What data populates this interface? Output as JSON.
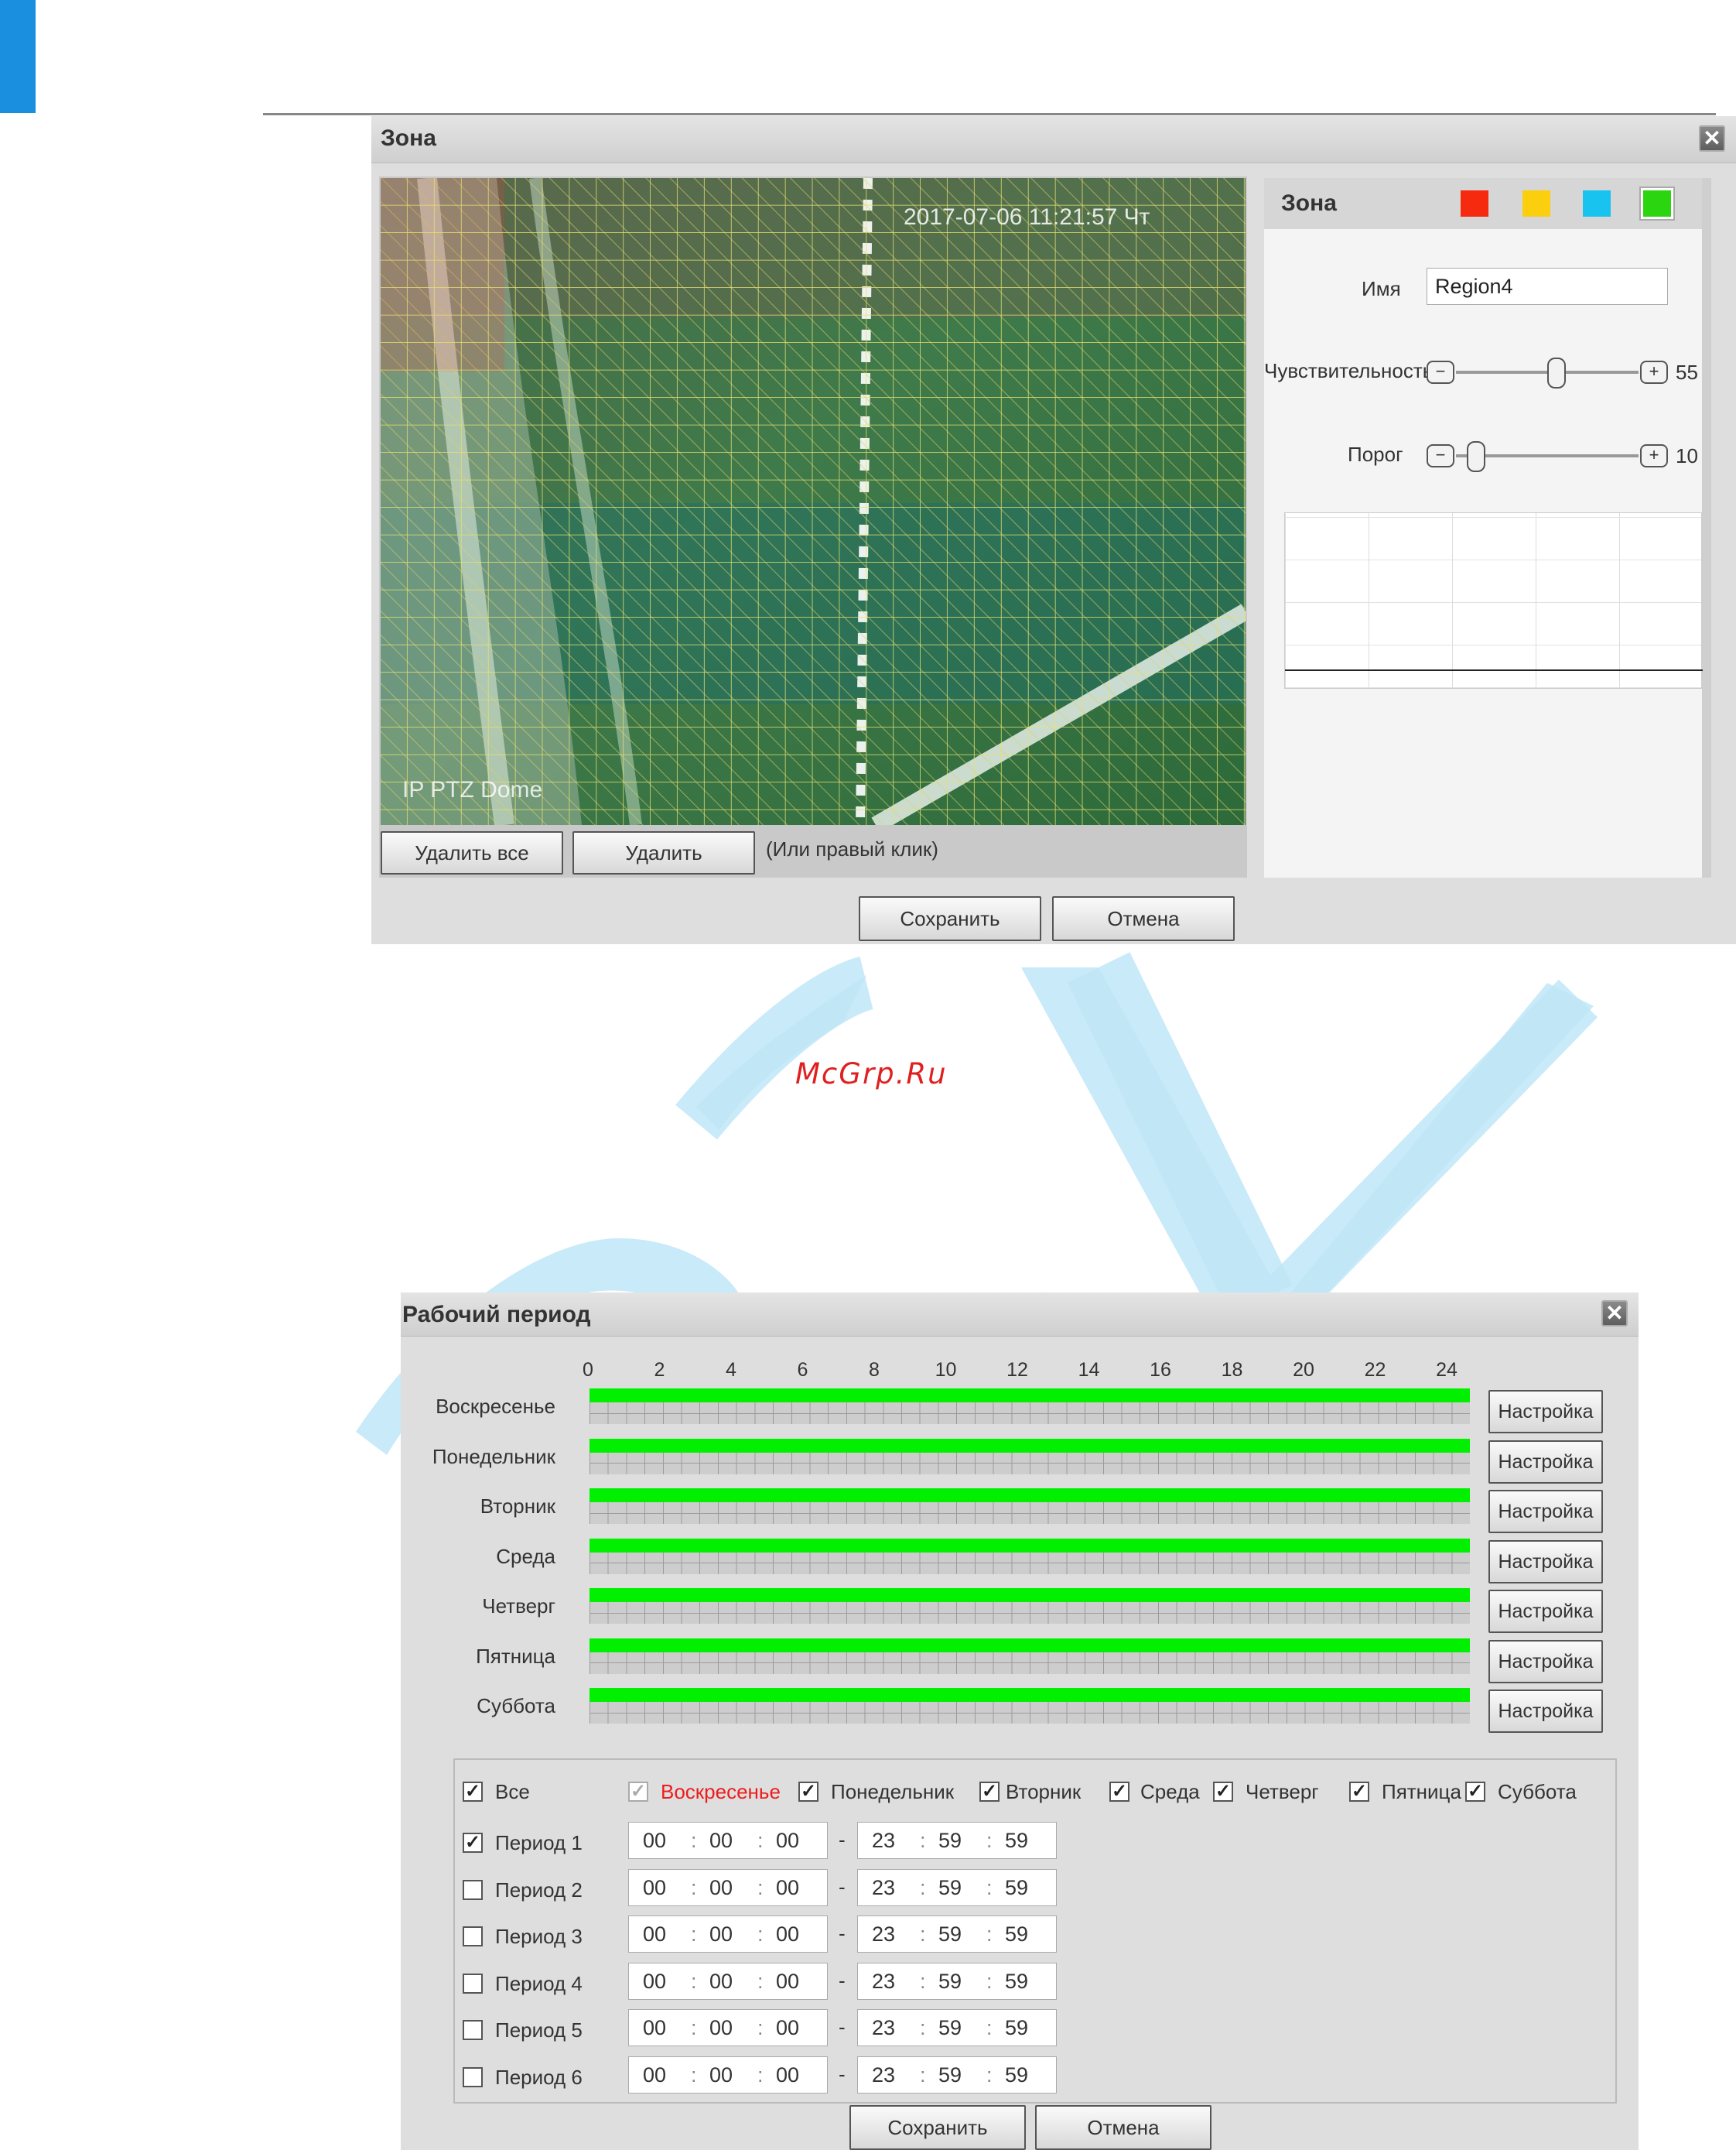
{
  "zone_dialog": {
    "title": "Зона",
    "close_glyph": "✕",
    "video": {
      "timestamp": "2017-07-06 11:21:57 Чт",
      "camera_label": "IP PTZ Dome"
    },
    "delete_all_label": "Удалить все",
    "delete_label": "Удалить",
    "hint": "(Или правый клик)",
    "save_label": "Сохранить",
    "cancel_label": "Отмена",
    "panel": {
      "title": "Зона",
      "colors": [
        "#f52a0f",
        "#fccf0e",
        "#19c3ef",
        "#2bd50f"
      ],
      "selected_color_index": 3,
      "name_label": "Имя",
      "name_value": "Region4",
      "sensitivity_label": "Чувствительность",
      "sensitivity_value": "55",
      "threshold_label": "Порог",
      "threshold_value": "10",
      "minus_glyph": "−",
      "plus_glyph": "+"
    }
  },
  "watermark": "McGrp.Ru",
  "work_period_dialog": {
    "title": "Рабочий период",
    "close_glyph": "✕",
    "hours": [
      "0",
      "2",
      "4",
      "6",
      "8",
      "10",
      "12",
      "14",
      "16",
      "18",
      "20",
      "22",
      "24"
    ],
    "days": [
      {
        "label": "Воскресенье",
        "button": "Настройка"
      },
      {
        "label": "Понедельник",
        "button": "Настройка"
      },
      {
        "label": "Вторник",
        "button": "Настройка"
      },
      {
        "label": "Среда",
        "button": "Настройка"
      },
      {
        "label": "Четверг",
        "button": "Настройка"
      },
      {
        "label": "Пятница",
        "button": "Настройка"
      },
      {
        "label": "Суббота",
        "button": "Настройка"
      }
    ],
    "all_label": "Все",
    "day_checkboxes": [
      {
        "label": "Воскресенье",
        "checked": true,
        "highlight": "#ee1c1c"
      },
      {
        "label": "Понедельник",
        "checked": true
      },
      {
        "label": "Вторник",
        "checked": true
      },
      {
        "label": "Среда",
        "checked": true
      },
      {
        "label": "Четверг",
        "checked": true
      },
      {
        "label": "Пятница",
        "checked": true
      },
      {
        "label": "Суббота",
        "checked": true
      }
    ],
    "periods": [
      {
        "label": "Период 1",
        "checked": true,
        "start": [
          "00",
          "00",
          "00"
        ],
        "end": [
          "23",
          "59",
          "59"
        ]
      },
      {
        "label": "Период 2",
        "checked": false,
        "start": [
          "00",
          "00",
          "00"
        ],
        "end": [
          "23",
          "59",
          "59"
        ]
      },
      {
        "label": "Период 3",
        "checked": false,
        "start": [
          "00",
          "00",
          "00"
        ],
        "end": [
          "23",
          "59",
          "59"
        ]
      },
      {
        "label": "Период 4",
        "checked": false,
        "start": [
          "00",
          "00",
          "00"
        ],
        "end": [
          "23",
          "59",
          "59"
        ]
      },
      {
        "label": "Период 5",
        "checked": false,
        "start": [
          "00",
          "00",
          "00"
        ],
        "end": [
          "23",
          "59",
          "59"
        ]
      },
      {
        "label": "Период 6",
        "checked": false,
        "start": [
          "00",
          "00",
          "00"
        ],
        "end": [
          "23",
          "59",
          "59"
        ]
      }
    ],
    "dash": "-",
    "colon": ":",
    "check_glyph": "✓",
    "save_label": "Сохранить",
    "cancel_label": "Отмена"
  }
}
